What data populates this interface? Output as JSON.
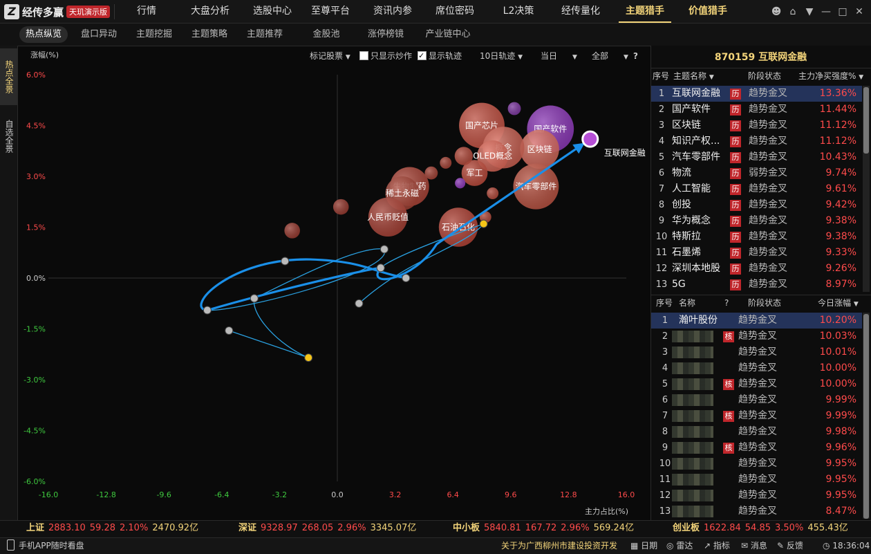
{
  "app": {
    "name": "经传多赢",
    "badge": "天玑演示版"
  },
  "nav": [
    "行情",
    "大盘分析",
    "选股中心",
    "至尊平台",
    "资讯内参",
    "席位密码",
    "L2决策",
    "经传量化",
    "主题猎手",
    "价值猎手"
  ],
  "subnav": [
    "热点纵览",
    "盘口异动",
    "主题挖掘",
    "主题策略",
    "主题推荐",
    "金股池",
    "涨停榜镜",
    "产业链中心"
  ],
  "side_tabs": [
    "热点全景",
    "自选全景"
  ],
  "chart_controls": {
    "mark": "标记股票",
    "only_speculate": "只显示炒作",
    "show_track": "显示轨迹",
    "track_days": "10日轨迹",
    "period": "当日",
    "scope": "全部",
    "help": "?"
  },
  "chart_data": {
    "type": "scatter",
    "ylabel": "涨幅(%)",
    "xlabel": "主力占比(%)",
    "xlim": [
      -16,
      16
    ],
    "ylim": [
      -6,
      6
    ],
    "x_ticks": [
      "-16.0",
      "-12.8",
      "-9.6",
      "-6.4",
      "-3.2",
      "0.0",
      "3.2",
      "6.4",
      "9.6",
      "12.8",
      "16.0"
    ],
    "y_ticks": [
      "6.0%",
      "4.5%",
      "3.0%",
      "1.5%",
      "0.0%",
      "-1.5%",
      "-3.0%",
      "-4.5%",
      "-6.0%"
    ],
    "highlight": {
      "name": "互联网金融",
      "x": 14.0,
      "y": 4.1
    },
    "bubbles": [
      {
        "label": "国产芯片",
        "x": 8.0,
        "y": 4.5,
        "r": 3.5,
        "color": "#d45a4a"
      },
      {
        "label": "国产软件",
        "x": 11.8,
        "y": 4.4,
        "r": 3.6,
        "color": "#9a3fc9"
      },
      {
        "label": "区块链",
        "x": 11.2,
        "y": 3.8,
        "r": 3.0,
        "color": "#e07060"
      },
      {
        "label": "概念",
        "x": 9.2,
        "y": 3.85,
        "r": 3.2,
        "color": "#d86858"
      },
      {
        "label": "OLED概念",
        "x": 8.6,
        "y": 3.6,
        "r": 2.4,
        "color": "#e06a5a"
      },
      {
        "label": "军工",
        "x": 7.6,
        "y": 3.1,
        "r": 2.0,
        "color": "#c85040"
      },
      {
        "label": "汽车零部件",
        "x": 11.0,
        "y": 2.7,
        "r": 3.5,
        "color": "#c85a48"
      },
      {
        "label": "生物制药",
        "x": 4.0,
        "y": 2.7,
        "r": 3.0,
        "color": "#b84a3c"
      },
      {
        "label": "稀土永磁",
        "x": 3.6,
        "y": 2.5,
        "r": 2.6,
        "color": "#a94437"
      },
      {
        "label": "人民币贬值",
        "x": 2.8,
        "y": 1.8,
        "r": 3.0,
        "color": "#b4473a"
      },
      {
        "label": "石油石化",
        "x": 6.7,
        "y": 1.5,
        "r": 3.0,
        "color": "#c0493b"
      },
      {
        "label": "",
        "x": 0.2,
        "y": 2.1,
        "r": 1.2,
        "color": "#a44034"
      },
      {
        "label": "",
        "x": -2.5,
        "y": 1.4,
        "r": 1.2,
        "color": "#a44034"
      },
      {
        "label": "",
        "x": 5.2,
        "y": 3.1,
        "r": 1.0,
        "color": "#b0483a"
      },
      {
        "label": "",
        "x": 6.0,
        "y": 3.4,
        "r": 0.9,
        "color": "#b0483a"
      },
      {
        "label": "",
        "x": 9.8,
        "y": 5.0,
        "r": 1.0,
        "color": "#8a3fb0"
      },
      {
        "label": "",
        "x": 7.0,
        "y": 3.6,
        "r": 1.4,
        "color": "#c05040"
      },
      {
        "label": "",
        "x": 6.8,
        "y": 2.8,
        "r": 0.8,
        "color": "#9a3fc9"
      },
      {
        "label": "",
        "x": 8.6,
        "y": 2.5,
        "r": 0.9,
        "color": "#c05040"
      },
      {
        "label": "",
        "x": 8.2,
        "y": 1.8,
        "r": 0.9,
        "color": "#c05040"
      }
    ],
    "track_nodes": [
      {
        "x": -6.0,
        "y": -1.55,
        "color": "#bbbbbb"
      },
      {
        "x": -1.6,
        "y": -2.35,
        "color": "#f5c518"
      },
      {
        "x": -7.2,
        "y": -0.95,
        "color": "#bbbbbb"
      },
      {
        "x": -4.6,
        "y": -0.6,
        "color": "#bbbbbb"
      },
      {
        "x": -2.9,
        "y": 0.5,
        "color": "#bbbbbb"
      },
      {
        "x": 2.6,
        "y": 0.85,
        "color": "#bbbbbb"
      },
      {
        "x": 2.4,
        "y": 0.3,
        "color": "#bbbbbb"
      },
      {
        "x": 3.8,
        "y": 0.0,
        "color": "#bbbbbb"
      },
      {
        "x": 1.2,
        "y": -0.75,
        "color": "#bbbbbb"
      },
      {
        "x": 8.1,
        "y": 1.6,
        "color": "#f5c518"
      }
    ]
  },
  "right_panel": {
    "title": "870159  互联网金融",
    "top_headers": {
      "idx": "序号",
      "name": "主题名称",
      "stage": "阶段状态",
      "strength": "主力净买强度%"
    },
    "themes": [
      {
        "idx": "1",
        "name": "互联网金融",
        "tag": "历",
        "stage": "趋势金叉",
        "pct": "13.36%"
      },
      {
        "idx": "2",
        "name": "国产软件",
        "tag": "历",
        "stage": "趋势金叉",
        "pct": "11.44%"
      },
      {
        "idx": "3",
        "name": "区块链",
        "tag": "历",
        "stage": "趋势金叉",
        "pct": "11.12%"
      },
      {
        "idx": "4",
        "name": "知识产权...",
        "tag": "历",
        "stage": "趋势金叉",
        "pct": "11.12%"
      },
      {
        "idx": "5",
        "name": "汽车零部件",
        "tag": "历",
        "stage": "趋势金叉",
        "pct": "10.43%"
      },
      {
        "idx": "6",
        "name": "物流",
        "tag": "历",
        "stage": "弱势金叉",
        "pct": "9.74%"
      },
      {
        "idx": "7",
        "name": "人工智能",
        "tag": "历",
        "stage": "趋势金叉",
        "pct": "9.61%"
      },
      {
        "idx": "8",
        "name": "创投",
        "tag": "历",
        "stage": "趋势金叉",
        "pct": "9.42%"
      },
      {
        "idx": "9",
        "name": "华为概念",
        "tag": "历",
        "stage": "趋势金叉",
        "pct": "9.38%"
      },
      {
        "idx": "10",
        "name": "特斯拉",
        "tag": "历",
        "stage": "趋势金叉",
        "pct": "9.38%"
      },
      {
        "idx": "11",
        "name": "石墨烯",
        "tag": "历",
        "stage": "趋势金叉",
        "pct": "9.33%"
      },
      {
        "idx": "12",
        "name": "深圳本地股",
        "tag": "历",
        "stage": "趋势金叉",
        "pct": "9.26%"
      },
      {
        "idx": "13",
        "name": "5G",
        "tag": "历",
        "stage": "趋势金叉",
        "pct": "8.97%"
      }
    ],
    "bottom_headers": {
      "idx": "序号",
      "name": "名称",
      "q": "?",
      "stage": "阶段状态",
      "change": "今日涨幅"
    },
    "stocks": [
      {
        "idx": "1",
        "name": "瀚叶股份",
        "tag": "",
        "stage": "趋势金叉",
        "pct": "10.20%"
      },
      {
        "idx": "2",
        "name": "",
        "tag": "核",
        "stage": "趋势金叉",
        "pct": "10.03%"
      },
      {
        "idx": "3",
        "name": "",
        "tag": "",
        "stage": "趋势金叉",
        "pct": "10.01%"
      },
      {
        "idx": "4",
        "name": "",
        "tag": "",
        "stage": "趋势金叉",
        "pct": "10.00%"
      },
      {
        "idx": "5",
        "name": "",
        "tag": "核",
        "stage": "趋势金叉",
        "pct": "10.00%"
      },
      {
        "idx": "6",
        "name": "",
        "tag": "",
        "stage": "趋势金叉",
        "pct": "9.99%"
      },
      {
        "idx": "7",
        "name": "",
        "tag": "核",
        "stage": "趋势金叉",
        "pct": "9.99%"
      },
      {
        "idx": "8",
        "name": "",
        "tag": "",
        "stage": "趋势金叉",
        "pct": "9.98%"
      },
      {
        "idx": "9",
        "name": "",
        "tag": "核",
        "stage": "趋势金叉",
        "pct": "9.96%"
      },
      {
        "idx": "10",
        "name": "",
        "tag": "",
        "stage": "趋势金叉",
        "pct": "9.95%"
      },
      {
        "idx": "11",
        "name": "",
        "tag": "",
        "stage": "趋势金叉",
        "pct": "9.95%"
      },
      {
        "idx": "12",
        "name": "",
        "tag": "",
        "stage": "趋势金叉",
        "pct": "9.95%"
      },
      {
        "idx": "13",
        "name": "",
        "tag": "",
        "stage": "趋势金叉",
        "pct": "8.47%"
      }
    ]
  },
  "indices": [
    {
      "name": "上证",
      "value": "2883.10",
      "change": "59.28",
      "pct": "2.10%",
      "amount": "2470.92亿"
    },
    {
      "name": "深证",
      "value": "9328.97",
      "change": "268.05",
      "pct": "2.96%",
      "amount": "3345.07亿"
    },
    {
      "name": "中小板",
      "value": "5840.81",
      "change": "167.72",
      "pct": "2.96%",
      "amount": "569.24亿"
    },
    {
      "name": "创业板",
      "value": "1622.84",
      "change": "54.85",
      "pct": "3.50%",
      "amount": "455.43亿"
    }
  ],
  "status": {
    "app_promo": "手机APP随时看盘",
    "news": "关于为广西柳州市建设投资开发",
    "items": [
      "日期",
      "雷达",
      "指标",
      "消息",
      "反馈"
    ],
    "time": "18:36:04"
  }
}
